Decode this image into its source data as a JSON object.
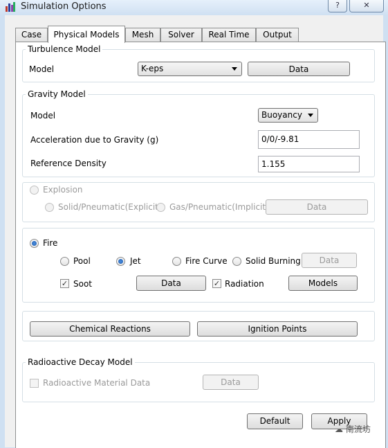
{
  "window": {
    "title": "Simulation Options",
    "help_label": "?",
    "close_label": "✕"
  },
  "tabs": [
    {
      "label": "Case"
    },
    {
      "label": "Physical Models"
    },
    {
      "label": "Mesh"
    },
    {
      "label": "Solver"
    },
    {
      "label": "Real Time"
    },
    {
      "label": "Output"
    }
  ],
  "turbulence": {
    "group_label": "Turbulence Model",
    "model_label": "Model",
    "model_value": "K-eps",
    "data_button": "Data"
  },
  "gravity": {
    "group_label": "Gravity Model",
    "model_label": "Model",
    "model_value": "Buoyancy",
    "accel_label": "Acceleration due to Gravity (g)",
    "accel_value": "0/0/-9.81",
    "density_label": "Reference Density",
    "density_value": "1.155"
  },
  "explosion": {
    "label": "Explosion",
    "solid_label": "Solid/Pneumatic(Explicit)",
    "gas_label": "Gas/Pneumatic(Implicit)",
    "data_button": "Data"
  },
  "fire": {
    "label": "Fire",
    "pool_label": "Pool",
    "jet_label": "Jet",
    "fire_curve_label": "Fire Curve",
    "solid_burning_label": "Solid Burning",
    "data_button_top": "Data",
    "soot_label": "Soot",
    "soot_data_button": "Data",
    "radiation_label": "Radiation",
    "models_button": "Models"
  },
  "actions": {
    "chemical_reactions": "Chemical Reactions",
    "ignition_points": "Ignition Points"
  },
  "radioactive": {
    "group_label": "Radioactive Decay Model",
    "material_label": "Radioactive Material Data",
    "data_button": "Data"
  },
  "footer": {
    "default_button": "Default",
    "apply_button": "Apply"
  },
  "watermark": "南流坊"
}
